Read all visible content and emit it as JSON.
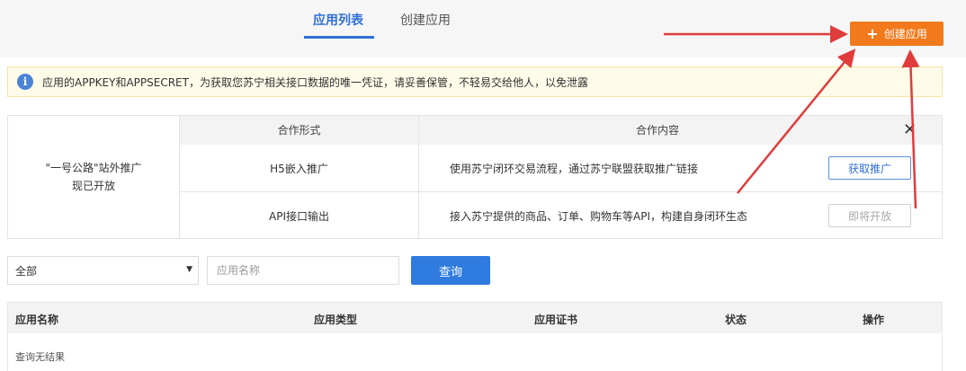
{
  "header": {
    "tabs": [
      {
        "label": "应用列表",
        "active": true
      },
      {
        "label": "创建应用",
        "active": false
      }
    ],
    "create_button_label": "创建应用",
    "create_button_icon": "plus-icon",
    "accent_color": "#2f6fd6",
    "create_button_color": "#f27a1c"
  },
  "notice": {
    "icon": "info-icon",
    "text": "应用的APPKEY和APPSECRET，为获取您苏宁相关接口数据的唯一凭证，请妥善保管，不轻易交给他人，以免泄露"
  },
  "cooperation": {
    "left_line1": "\"一号公路\"站外推广",
    "left_line2": "现已开放",
    "headers": [
      "合作形式",
      "合作内容"
    ],
    "rows": [
      {
        "form": "H5嵌入推广",
        "content": "使用苏宁闭环交易流程，通过苏宁联盟获取推广链接",
        "action": "获取推广",
        "enabled": true
      },
      {
        "form": "API接口输出",
        "content": "接入苏宁提供的商品、订单、购物车等API，构建自身闭环生态",
        "action": "即将开放",
        "enabled": false
      }
    ]
  },
  "filters": {
    "select_value": "全部",
    "name_placeholder": "应用名称",
    "search_label": "查询"
  },
  "table": {
    "columns": [
      "应用名称",
      "应用类型",
      "应用证书",
      "状态",
      "操作"
    ],
    "empty_text": "查询无结果"
  }
}
